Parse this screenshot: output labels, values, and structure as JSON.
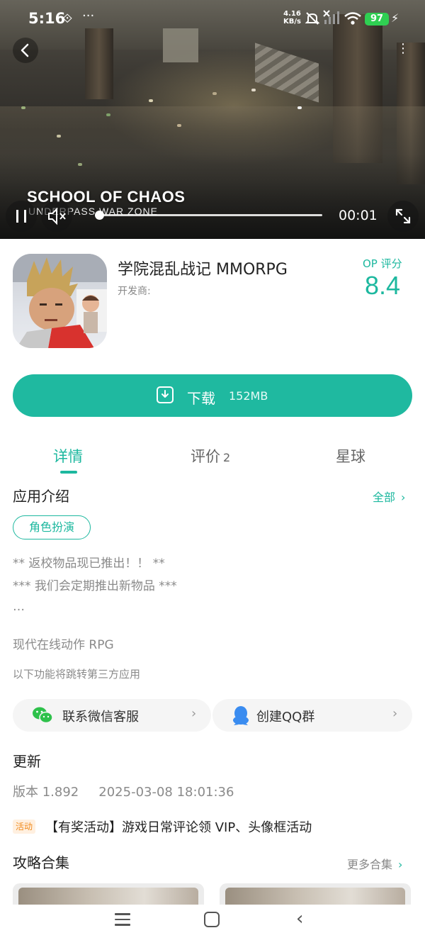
{
  "status_bar": {
    "time": "5:16",
    "extra_glyph": "⟐",
    "more": "···",
    "net_speed": "4.16",
    "net_unit": "KB/s",
    "battery": "97"
  },
  "video": {
    "title": "SCHOOL OF CHAOS",
    "subtitle": "UNDERPASS WAR ZONE",
    "time": "00:01",
    "progress": 0.0
  },
  "app": {
    "name": "学院混乱战记 MMORPG",
    "developer_label": "开发商:",
    "rating_label": "OP 评分",
    "rating_value": "8.4"
  },
  "download": {
    "label": "下载",
    "size": "152MB"
  },
  "tabs": [
    {
      "label": "详情",
      "count": ""
    },
    {
      "label": "评价",
      "count": "2"
    },
    {
      "label": "星球",
      "count": ""
    }
  ],
  "intro": {
    "title": "应用介绍",
    "all_link": "全部",
    "tag": "角色扮演",
    "lines": [
      "** 返校物品现已推出！！ **",
      "*** 我们会定期推出新物品 ***",
      "…"
    ],
    "summary": "现代在线动作 RPG",
    "third_party_note": "以下功能将跳转第三方应用"
  },
  "contacts": {
    "wechat": "联系微信客服",
    "qq": "创建QQ群"
  },
  "update": {
    "title": "更新",
    "version": "版本 1.892",
    "date": "2025-03-08 18:01:36",
    "badge": "活动",
    "event": "【有奖活动】游戏日常评论领 VIP、头像框活动"
  },
  "guides": {
    "title": "攻略合集",
    "more_link": "更多合集"
  },
  "colors": {
    "accent": "#1db89f",
    "button": "#1fb9a0",
    "battery": "#2fcf52",
    "badge_text": "#f08a1c"
  }
}
